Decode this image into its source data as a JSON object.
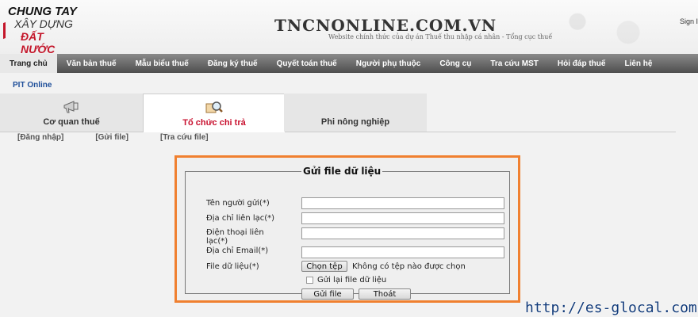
{
  "header": {
    "logo_lines": [
      "CHUNG TAY",
      "XÂY DỰNG",
      "ĐẤT NƯỚC"
    ],
    "site_title": "TNCNONLINE.COM.VN",
    "site_subtitle": "Website chính thức của dự án Thuế thu nhập cá nhân - Tổng cục thuế",
    "signin_label": "Sign I"
  },
  "nav": {
    "items": [
      "Trang chủ",
      "Văn bản thuế",
      "Mẫu biểu thuế",
      "Đăng ký thuế",
      "Quyết toán thuế",
      "Người phụ thuộc",
      "Công cụ",
      "Tra cứu MST",
      "Hỏi đáp thuế",
      "Liên hệ"
    ],
    "active": "Trang chủ"
  },
  "breadcrumb": "PIT Online",
  "tabs": [
    {
      "label": "Cơ quan thuế",
      "icon": "megaphone-icon"
    },
    {
      "label": "Tổ chức chi trả",
      "icon": "magnifier-icon"
    },
    {
      "label": "Phi nông nghiệp",
      "icon": ""
    }
  ],
  "sublinks": [
    "[Đăng nhập]",
    "[Gửi file]",
    "[Tra cứu file]"
  ],
  "form": {
    "legend": "Gửi file dữ liệu",
    "sender_name_label": "Tên người gửi(*)",
    "address_label": "Địa chỉ liên lạc(*)",
    "phone_label_line1": "Điện thoại liên",
    "phone_label_line2": "lạc(*)",
    "email_label": "Địa chỉ Email(*)",
    "file_label": "File dữ liệu(*)",
    "choose_file_button": "Chọn tệp",
    "no_file_text": "Không có tệp nào được chọn",
    "resend_label": "Gửi lại file dữ liệu",
    "submit_button": "Gửi file",
    "exit_button": "Thoát"
  },
  "watermark": "http://es-glocal.com",
  "colors": {
    "highlight_border": "#f08030",
    "nav_bg": "#5a5a5a",
    "active_tab_text": "#c8102e",
    "link_blue": "#1f4f9a"
  }
}
